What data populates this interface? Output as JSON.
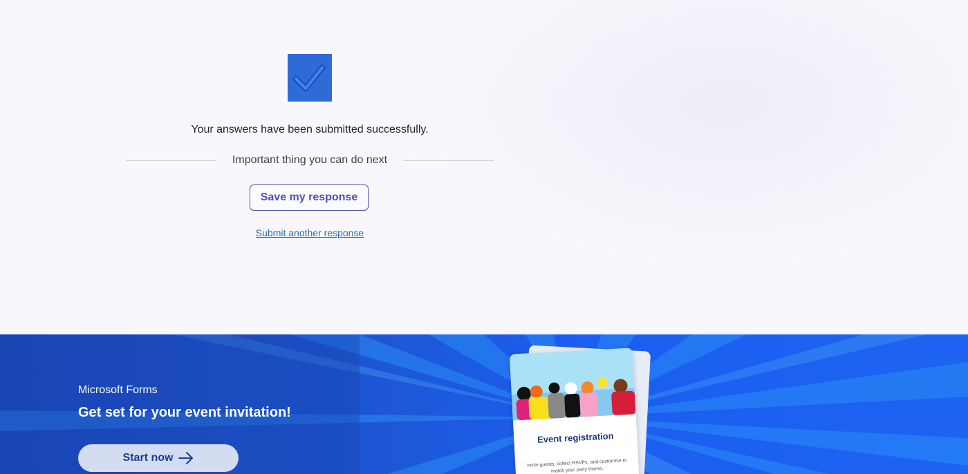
{
  "confirmation": {
    "message": "Your answers have been submitted successfully.",
    "next_heading": "Important thing you can do next",
    "save_button": "Save my response",
    "submit_another_link": "Submit another response"
  },
  "promo": {
    "brand": "Microsoft Forms",
    "headline": "Get set for your event invitation!",
    "start_button": "Start now",
    "card": {
      "title": "Event registration",
      "description": "Invite guests, collect RSVPs, and customise to match your party theme."
    }
  },
  "colors": {
    "accent": "#4f52b2",
    "link": "#2a6ab5",
    "check_tile": "#2e6bd6",
    "promo_bg": "#1d57d6"
  },
  "icons": {
    "check": "checkmark-icon",
    "arrow": "arrow-right-icon"
  }
}
